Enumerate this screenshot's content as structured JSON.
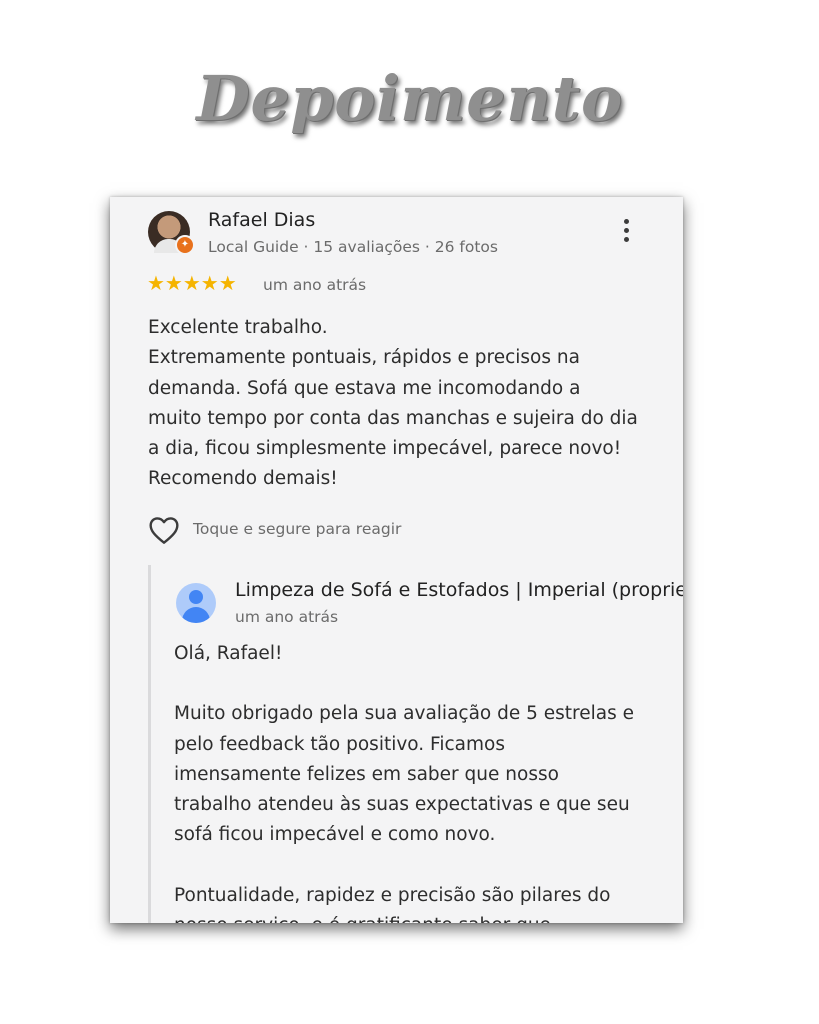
{
  "heading": "Depoimento",
  "review": {
    "reviewer_name": "Rafael Dias",
    "reviewer_meta": "Local Guide · 15 avaliações · 26 fotos",
    "avatar_icon": "user-photo",
    "more_icon": "more-vert-icon",
    "rating": 5,
    "stars": "★★★★★",
    "star_color": "#f5b400",
    "date": "um ano atrás",
    "text": "Excelente trabalho.\nExtremamente pontuais, rápidos e precisos na\ndemanda. Sofá que estava me incomodando a\nmuito tempo por conta das manchas e sujeira do dia\na dia, ficou simplesmente impecável, parece novo!\nRecomendo demais!",
    "react_hint": "Toque e segure para reagir",
    "heart_icon": "heart-outline-icon"
  },
  "reply": {
    "owner_name": "Limpeza de Sofá e Estofados | Imperial (proprie",
    "owner_avatar_color": "#4285f4",
    "date": "um ano atrás",
    "text": "Olá, Rafael!\n\nMuito obrigado pela sua avaliação de 5 estrelas e\npelo feedback tão positivo. Ficamos\nimensamente felizes em saber que nosso\ntrabalho atendeu às suas expectativas e que seu\nsofá ficou impecável e como novo.\n\nPontualidade, rapidez e precisão são pilares do\nnosso serviço, e é gratificante saber que"
  }
}
